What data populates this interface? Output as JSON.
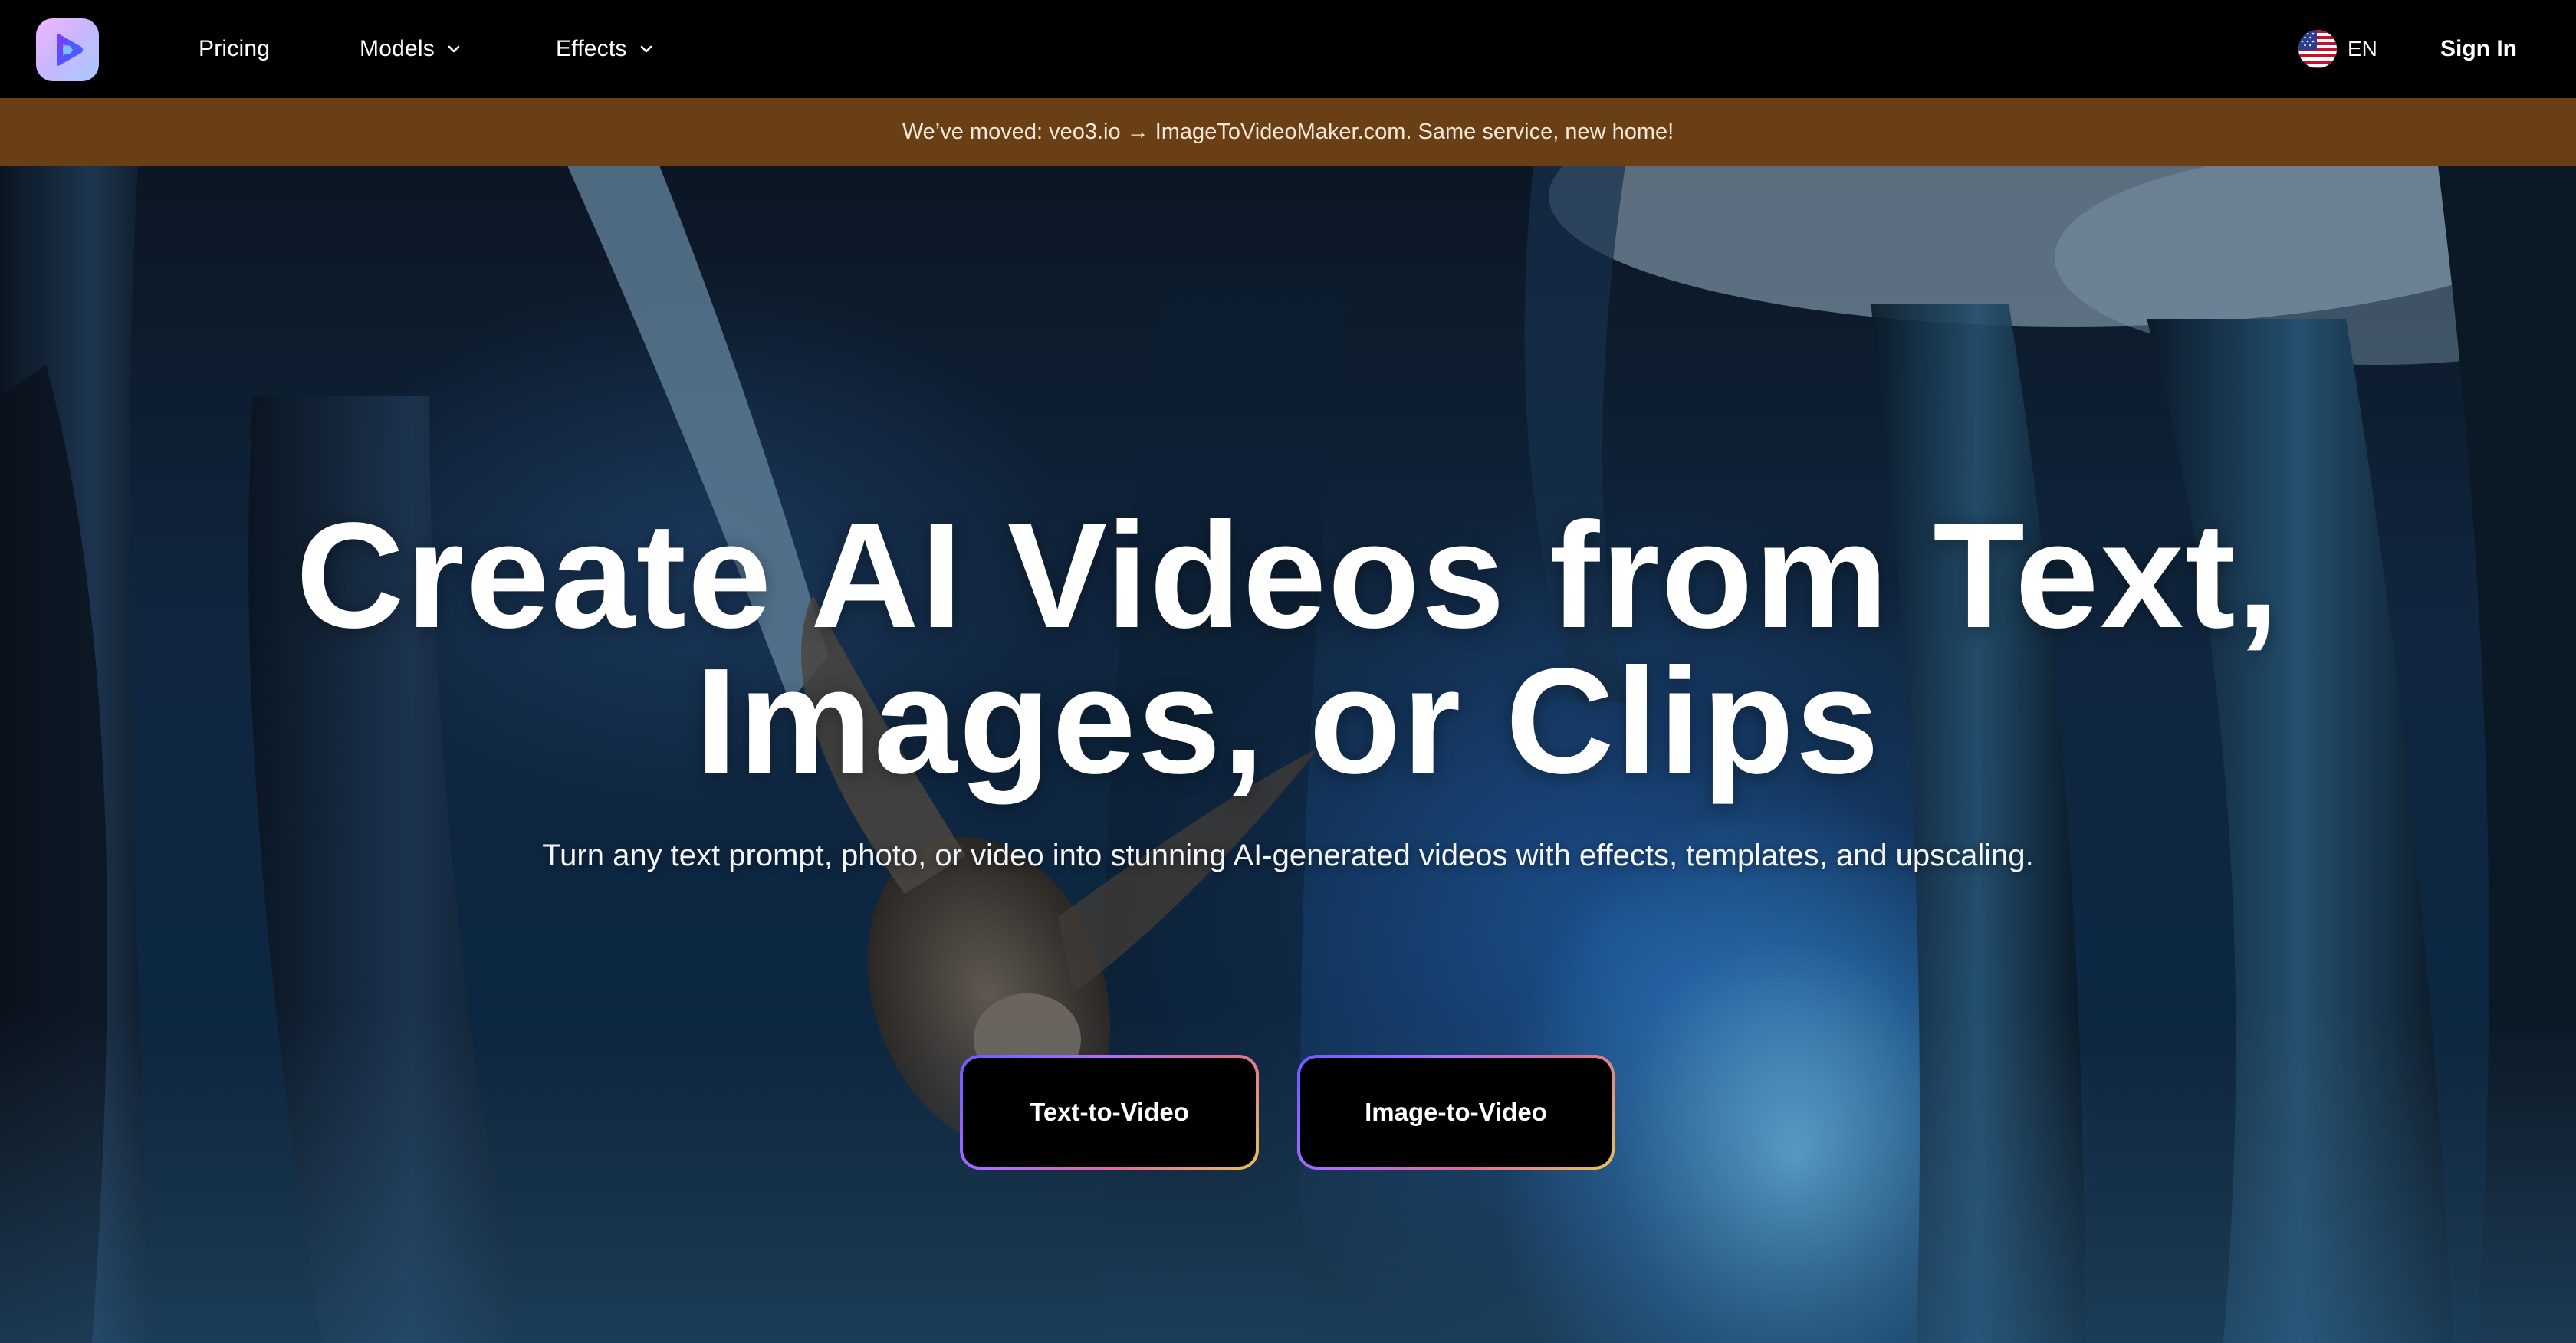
{
  "nav": {
    "logo_icon": "play-logo-icon",
    "pricing": "Pricing",
    "models": "Models",
    "effects": "Effects",
    "language": "EN",
    "flag_icon": "us-flag-icon",
    "sign_in": "Sign In"
  },
  "banner": {
    "text": "We’ve moved: veo3.io → ImageToVideoMaker.com. Same service, new home!"
  },
  "hero": {
    "title_line1": "Create AI Videos from Text,",
    "title_line2": "Images, or Clips",
    "subtitle": "Turn any text prompt, photo, or video into stunning AI-generated videos with effects, templates, and upscaling.",
    "cta_text_to_video": "Text-to-Video",
    "cta_image_to_video": "Image-to-Video"
  },
  "colors": {
    "banner_bg": "#6b3f16",
    "navbar_bg": "#000000",
    "cta_bg": "#000000"
  }
}
